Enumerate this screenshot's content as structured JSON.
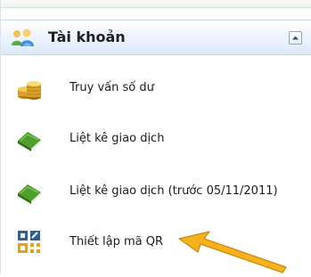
{
  "account_panel": {
    "title": "Tài khoản",
    "header_icon": "users-icon",
    "collapse_icon": "collapse-up-icon",
    "items": [
      {
        "label": "Truy vấn số dư",
        "icon": "coin-stack-icon"
      },
      {
        "label": "Liệt kê giao dịch",
        "icon": "green-book-icon"
      },
      {
        "label": "Liệt kê giao dịch (trước 05/11/2011)",
        "icon": "green-book-icon"
      },
      {
        "label": "Thiết lập mã QR",
        "icon": "qr-code-icon"
      }
    ]
  },
  "annotation": {
    "icon": "pointer-arrow-icon",
    "color": "#f6b21c"
  }
}
